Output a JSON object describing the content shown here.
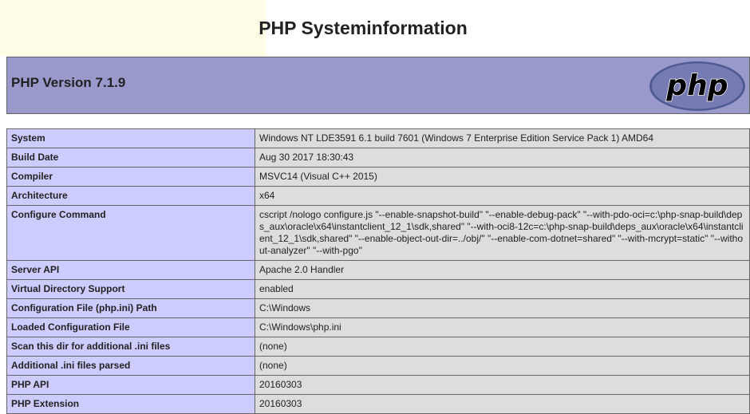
{
  "page": {
    "title": "PHP Systeminformation"
  },
  "header": {
    "version": "PHP Version 7.1.9",
    "logo_text": "php"
  },
  "rows": [
    {
      "key": "System",
      "value": "Windows NT LDE3591 6.1 build 7601 (Windows 7 Enterprise Edition Service Pack 1) AMD64"
    },
    {
      "key": "Build Date",
      "value": "Aug 30 2017 18:30:43"
    },
    {
      "key": "Compiler",
      "value": "MSVC14 (Visual C++ 2015)"
    },
    {
      "key": "Architecture",
      "value": "x64"
    },
    {
      "key": "Configure Command",
      "value": "cscript /nologo configure.js \"--enable-snapshot-build\" \"--enable-debug-pack\" \"--with-pdo-oci=c:\\php-snap-build\\deps_aux\\oracle\\x64\\instantclient_12_1\\sdk,shared\" \"--with-oci8-12c=c:\\php-snap-build\\deps_aux\\oracle\\x64\\instantclient_12_1\\sdk,shared\" \"--enable-object-out-dir=../obj/\" \"--enable-com-dotnet=shared\" \"--with-mcrypt=static\" \"--without-analyzer\" \"--with-pgo\""
    },
    {
      "key": "Server API",
      "value": "Apache 2.0 Handler"
    },
    {
      "key": "Virtual Directory Support",
      "value": "enabled"
    },
    {
      "key": "Configuration File (php.ini) Path",
      "value": "C:\\Windows"
    },
    {
      "key": "Loaded Configuration File",
      "value": "C:\\Windows\\php.ini"
    },
    {
      "key": "Scan this dir for additional .ini files",
      "value": "(none)"
    },
    {
      "key": "Additional .ini files parsed",
      "value": "(none)"
    },
    {
      "key": "PHP API",
      "value": "20160303"
    },
    {
      "key": "PHP Extension",
      "value": "20160303"
    }
  ],
  "colors": {
    "header_band": "#9999cc",
    "key_cell": "#ccccff",
    "value_cell": "#dddddd",
    "logo_fill": "#777bb3"
  }
}
